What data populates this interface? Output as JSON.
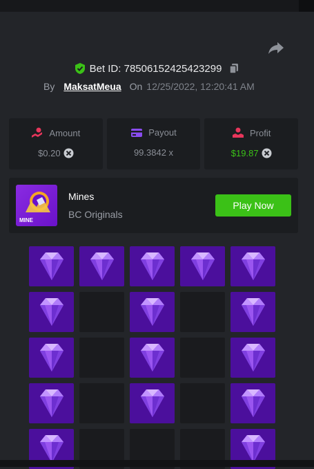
{
  "header": {
    "bet_id": "Bet ID: 78506152425423299",
    "by_label": "By",
    "username": "MaksatMeua",
    "on_label": "On",
    "date": "12/25/2022, 12:20:41 AM"
  },
  "stats": [
    {
      "label": "Amount",
      "value": "$0.20",
      "icon": "amount-icon"
    },
    {
      "label": "Payout",
      "value": "99.3842 x",
      "icon": "payout-icon"
    },
    {
      "label": "Profit",
      "value": "$19.87",
      "icon": "profit-icon"
    }
  ],
  "game": {
    "name": "Mines",
    "provider": "BC Originals",
    "thumb_label": "MINE",
    "play_label": "Play Now"
  },
  "board": {
    "rows": 5,
    "cols": 5,
    "tiles": [
      "gem",
      "gem",
      "gem",
      "gem",
      "gem",
      "gem",
      "empty",
      "gem",
      "empty",
      "gem",
      "gem",
      "empty",
      "gem",
      "empty",
      "gem",
      "gem",
      "empty",
      "gem",
      "empty",
      "gem",
      "gem",
      "empty",
      "empty",
      "empty",
      "gem"
    ]
  },
  "colors": {
    "background": "#232529",
    "panel": "#1b1d20",
    "accent_green": "#3bc117",
    "gem_tile": "#4b0f9c",
    "empty_tile": "#1a1b1e"
  }
}
